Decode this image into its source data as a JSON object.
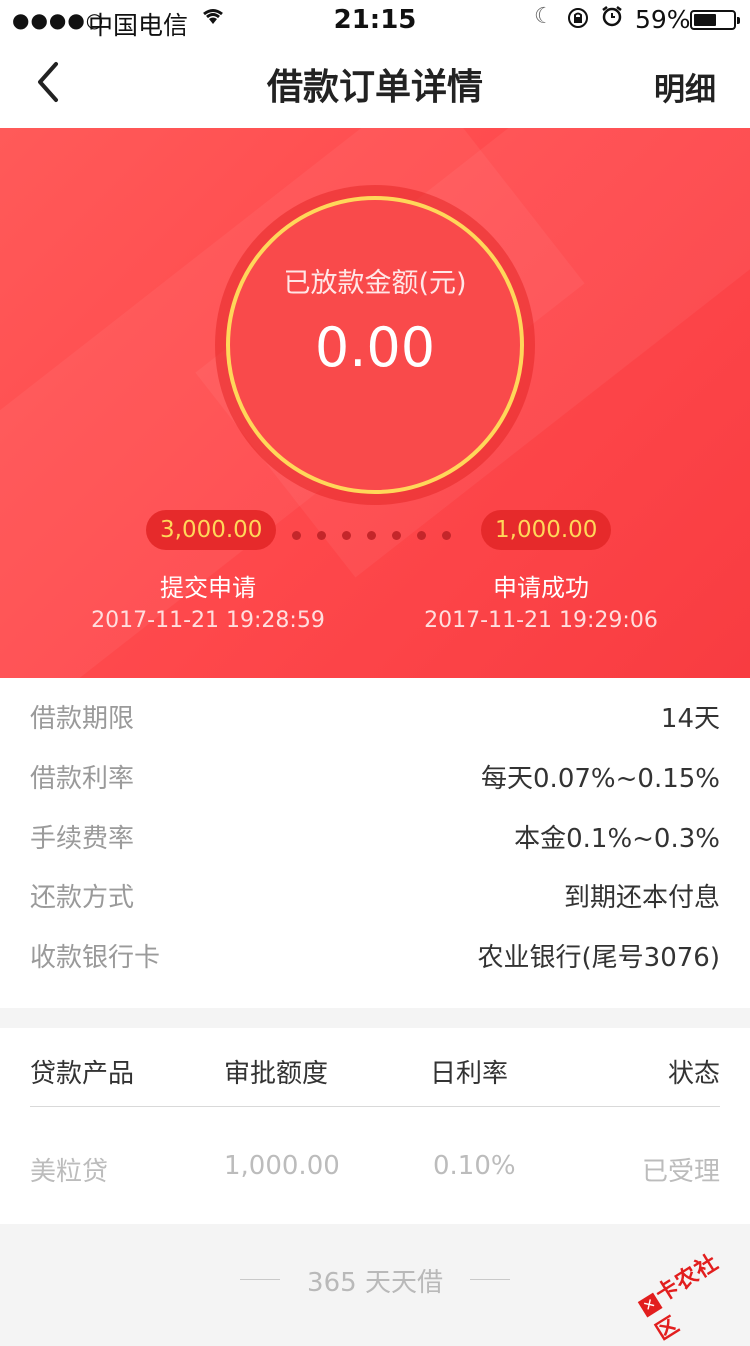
{
  "status_bar": {
    "signal": "●●●●○",
    "carrier": "中国电信",
    "time": "21:15",
    "battery_percent": "59%",
    "battery_level": 0.59,
    "icons": [
      "signal-icon",
      "wifi-icon",
      "moon-icon",
      "rotation-lock-icon",
      "alarm-icon",
      "battery-icon"
    ]
  },
  "nav": {
    "title": "借款订单详情",
    "detail_button": "明细"
  },
  "hero": {
    "amount_label": "已放款金额(元)",
    "amount": "0.00",
    "submitted_amount": "3,000.00",
    "approved_amount": "1,000.00",
    "step1_label": "提交申请",
    "step1_time": "2017-11-21 19:28:59",
    "step2_label": "申请成功",
    "step2_time": "2017-11-21 19:29:06",
    "colors": {
      "primary": "#ff4a4d",
      "ring": "#ffd75a"
    }
  },
  "info": {
    "rows": [
      {
        "label": "借款期限",
        "value": "14天"
      },
      {
        "label": "借款利率",
        "value": "每天0.07%~0.15%"
      },
      {
        "label": "手续费率",
        "value": "本金0.1%~0.3%"
      },
      {
        "label": "还款方式",
        "value": "到期还本付息"
      },
      {
        "label": "收款银行卡",
        "value": "农业银行(尾号3076)"
      }
    ]
  },
  "table": {
    "headers": [
      "贷款产品",
      "审批额度",
      "日利率",
      "状态"
    ],
    "rows": [
      [
        "美粒贷",
        "1,000.00",
        "0.10%",
        "已受理"
      ]
    ]
  },
  "footer": {
    "text": "365 天天借"
  },
  "watermark": {
    "text": "卡农社区"
  }
}
